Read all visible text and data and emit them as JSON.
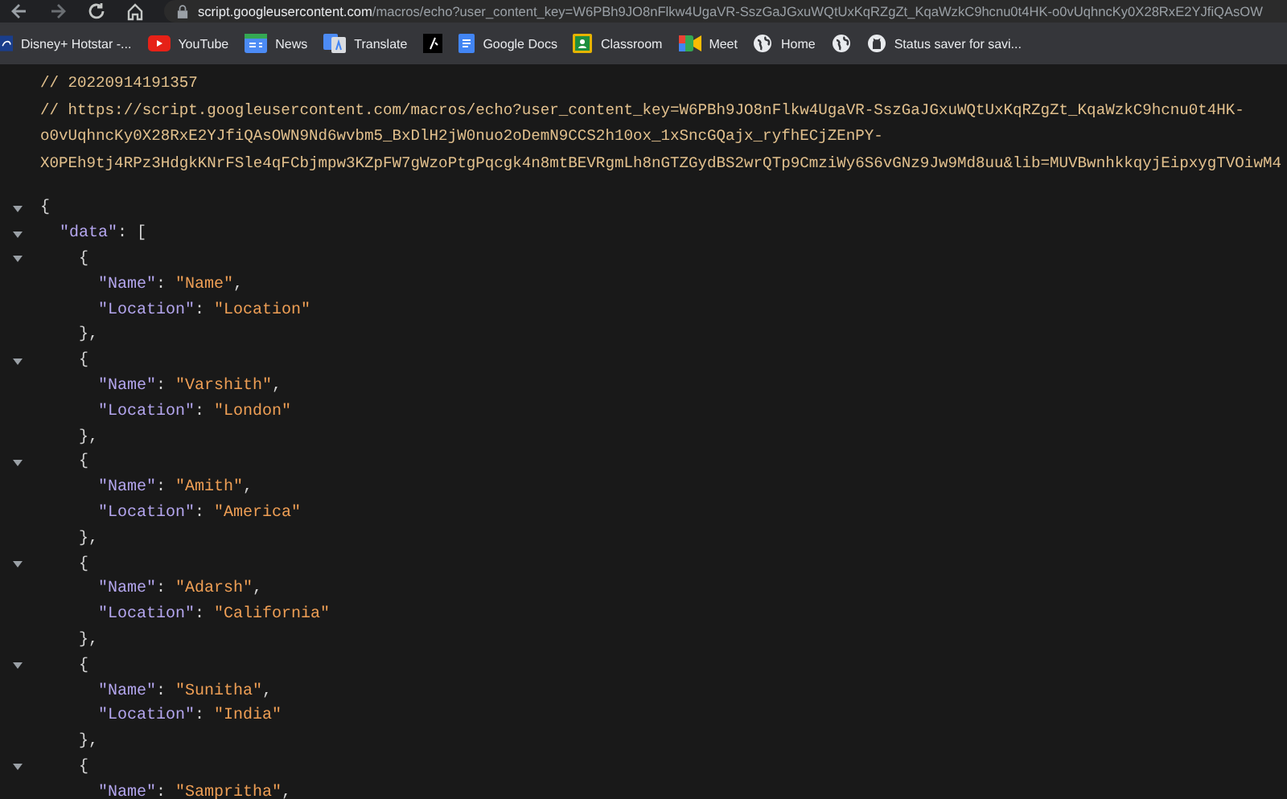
{
  "browser": {
    "address": {
      "host": "script.googleusercontent.com",
      "path": "/macros/echo?user_content_key=W6PBh9JO8nFlkw4UgaVR-SszGaJGxuWQtUxKqRZgZt_KqaWzkC9hcnu0t4HK-o0vUqhncKy0X28RxE2YJfiQAsOW"
    },
    "bookmarks": [
      {
        "label": "Disney+ Hotstar -...",
        "kind": "disney"
      },
      {
        "label": "YouTube",
        "kind": "youtube"
      },
      {
        "label": "News",
        "kind": "news"
      },
      {
        "label": "Translate",
        "kind": "translate"
      },
      {
        "kind": "dark"
      },
      {
        "label": "Google Docs",
        "kind": "docs"
      },
      {
        "label": "Classroom",
        "kind": "classroom"
      },
      {
        "label": "Meet",
        "kind": "meet"
      },
      {
        "label": "Home",
        "kind": "globe"
      },
      {
        "kind": "globe"
      },
      {
        "label": "Status saver for savi...",
        "kind": "github"
      }
    ]
  },
  "comments": [
    "// 20220914191357",
    "// https://script.googleusercontent.com/macros/echo?user_content_key=W6PBh9JO8nFlkw4UgaVR-SszGaJGxuWQtUxKqRZgZt_KqaWzkC9hcnu0t4HK-",
    "o0vUqhncKy0X28RxE2YJfiQAsOWN9Nd6wvbm5_BxDlH2jW0nuo2oDemN9CCS2h10ox_1xSncGQajx_ryfhECjZEnPY-",
    "X0PEh9tj4RPz3HdgkKNrFSle4qFCbjmpw3KZpFW7gWzoPtgPqcgk4n8mtBEVRgmLh8nGTZGydBS2wrQTp9CmziWy6S6vGNz9Jw9Md8uu&lib=MUVBwnhkkqyjEipxygTVOiwM4"
  ],
  "code": {
    "tokens": [
      {
        "kind": "punct",
        "text": "{"
      }
    ],
    "expanded": true,
    "children": [
      {
        "tokens": [
          {
            "kind": "key",
            "text": "\"data\""
          },
          {
            "kind": "colon",
            "text": ":"
          },
          {
            "kind": "punct",
            "text": "["
          }
        ],
        "expanded": true,
        "children": [
          {
            "tokens": [
              {
                "kind": "punct",
                "text": "{"
              }
            ],
            "expanded": true,
            "children": [
              {
                "tokens": [
                  {
                    "kind": "key",
                    "text": "\"Name\""
                  },
                  {
                    "kind": "colon",
                    "text": ":"
                  },
                  {
                    "kind": "string",
                    "text": "\"Name\""
                  },
                  {
                    "kind": "punct",
                    "text": ","
                  }
                ]
              },
              {
                "tokens": [
                  {
                    "kind": "key",
                    "text": "\"Location\""
                  },
                  {
                    "kind": "colon",
                    "text": ":"
                  },
                  {
                    "kind": "string",
                    "text": "\"Location\""
                  }
                ]
              }
            ],
            "close": [
              {
                "kind": "punct",
                "text": "},"
              }
            ]
          },
          {
            "tokens": [
              {
                "kind": "punct",
                "text": "{"
              }
            ],
            "expanded": true,
            "children": [
              {
                "tokens": [
                  {
                    "kind": "key",
                    "text": "\"Name\""
                  },
                  {
                    "kind": "colon",
                    "text": ":"
                  },
                  {
                    "kind": "string",
                    "text": "\"Varshith\""
                  },
                  {
                    "kind": "punct",
                    "text": ","
                  }
                ]
              },
              {
                "tokens": [
                  {
                    "kind": "key",
                    "text": "\"Location\""
                  },
                  {
                    "kind": "colon",
                    "text": ":"
                  },
                  {
                    "kind": "string",
                    "text": "\"London\""
                  }
                ]
              }
            ],
            "close": [
              {
                "kind": "punct",
                "text": "},"
              }
            ]
          },
          {
            "tokens": [
              {
                "kind": "punct",
                "text": "{"
              }
            ],
            "expanded": true,
            "children": [
              {
                "tokens": [
                  {
                    "kind": "key",
                    "text": "\"Name\""
                  },
                  {
                    "kind": "colon",
                    "text": ":"
                  },
                  {
                    "kind": "string",
                    "text": "\"Amith\""
                  },
                  {
                    "kind": "punct",
                    "text": ","
                  }
                ]
              },
              {
                "tokens": [
                  {
                    "kind": "key",
                    "text": "\"Location\""
                  },
                  {
                    "kind": "colon",
                    "text": ":"
                  },
                  {
                    "kind": "string",
                    "text": "\"America\""
                  }
                ]
              }
            ],
            "close": [
              {
                "kind": "punct",
                "text": "},"
              }
            ]
          },
          {
            "tokens": [
              {
                "kind": "punct",
                "text": "{"
              }
            ],
            "expanded": true,
            "children": [
              {
                "tokens": [
                  {
                    "kind": "key",
                    "text": "\"Name\""
                  },
                  {
                    "kind": "colon",
                    "text": ":"
                  },
                  {
                    "kind": "string",
                    "text": "\"Adarsh\""
                  },
                  {
                    "kind": "punct",
                    "text": ","
                  }
                ]
              },
              {
                "tokens": [
                  {
                    "kind": "key",
                    "text": "\"Location\""
                  },
                  {
                    "kind": "colon",
                    "text": ":"
                  },
                  {
                    "kind": "string",
                    "text": "\"California\""
                  }
                ]
              }
            ],
            "close": [
              {
                "kind": "punct",
                "text": "},"
              }
            ]
          },
          {
            "tokens": [
              {
                "kind": "punct",
                "text": "{"
              }
            ],
            "expanded": true,
            "children": [
              {
                "tokens": [
                  {
                    "kind": "key",
                    "text": "\"Name\""
                  },
                  {
                    "kind": "colon",
                    "text": ":"
                  },
                  {
                    "kind": "string",
                    "text": "\"Sunitha\""
                  },
                  {
                    "kind": "punct",
                    "text": ","
                  }
                ]
              },
              {
                "tokens": [
                  {
                    "kind": "key",
                    "text": "\"Location\""
                  },
                  {
                    "kind": "colon",
                    "text": ":"
                  },
                  {
                    "kind": "string",
                    "text": "\"India\""
                  }
                ]
              }
            ],
            "close": [
              {
                "kind": "punct",
                "text": "},"
              }
            ]
          },
          {
            "tokens": [
              {
                "kind": "punct",
                "text": "{"
              }
            ],
            "expanded": true,
            "children": [
              {
                "tokens": [
                  {
                    "kind": "key",
                    "text": "\"Name\""
                  },
                  {
                    "kind": "colon",
                    "text": ":"
                  },
                  {
                    "kind": "string",
                    "text": "\"Sampritha\""
                  },
                  {
                    "kind": "punct",
                    "text": ","
                  }
                ]
              }
            ]
          }
        ]
      }
    ]
  }
}
